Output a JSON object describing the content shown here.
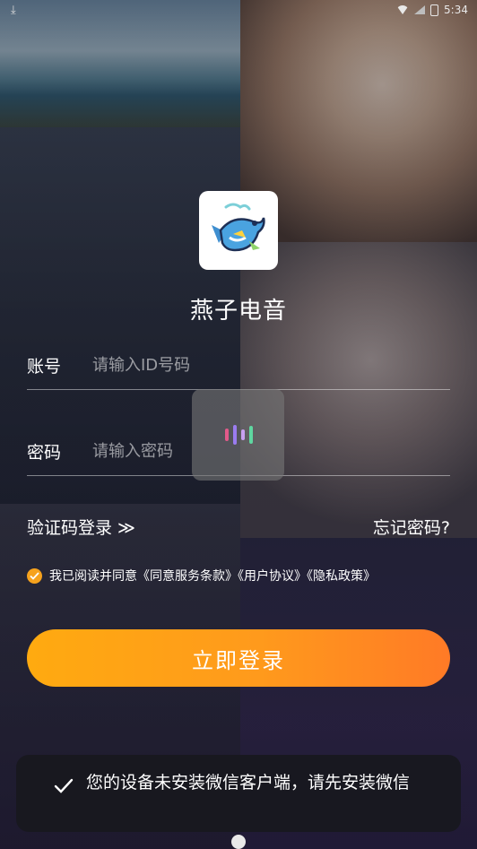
{
  "status_bar": {
    "time": "5:34"
  },
  "app": {
    "name": "燕子电音",
    "logo_icon": "swallow-bird-logo"
  },
  "form": {
    "account_label": "账号",
    "account_placeholder": "请输入ID号码",
    "password_label": "密码",
    "password_placeholder": "请输入密码"
  },
  "links": {
    "sms_login": "验证码登录 ≫",
    "forgot_password": "忘记密码?"
  },
  "agreement": {
    "checked": true,
    "text": "我已阅读并同意《同意服务条款》《用户协议》《隐私政策》"
  },
  "login_button": "立即登录",
  "toast": {
    "icon": "check-icon",
    "message": "您的设备未安装微信客户端，请先安装微信"
  },
  "colors": {
    "accent_start": "#ffaa10",
    "accent_end": "#ff7a26",
    "checkbox": "#f6a21d"
  }
}
